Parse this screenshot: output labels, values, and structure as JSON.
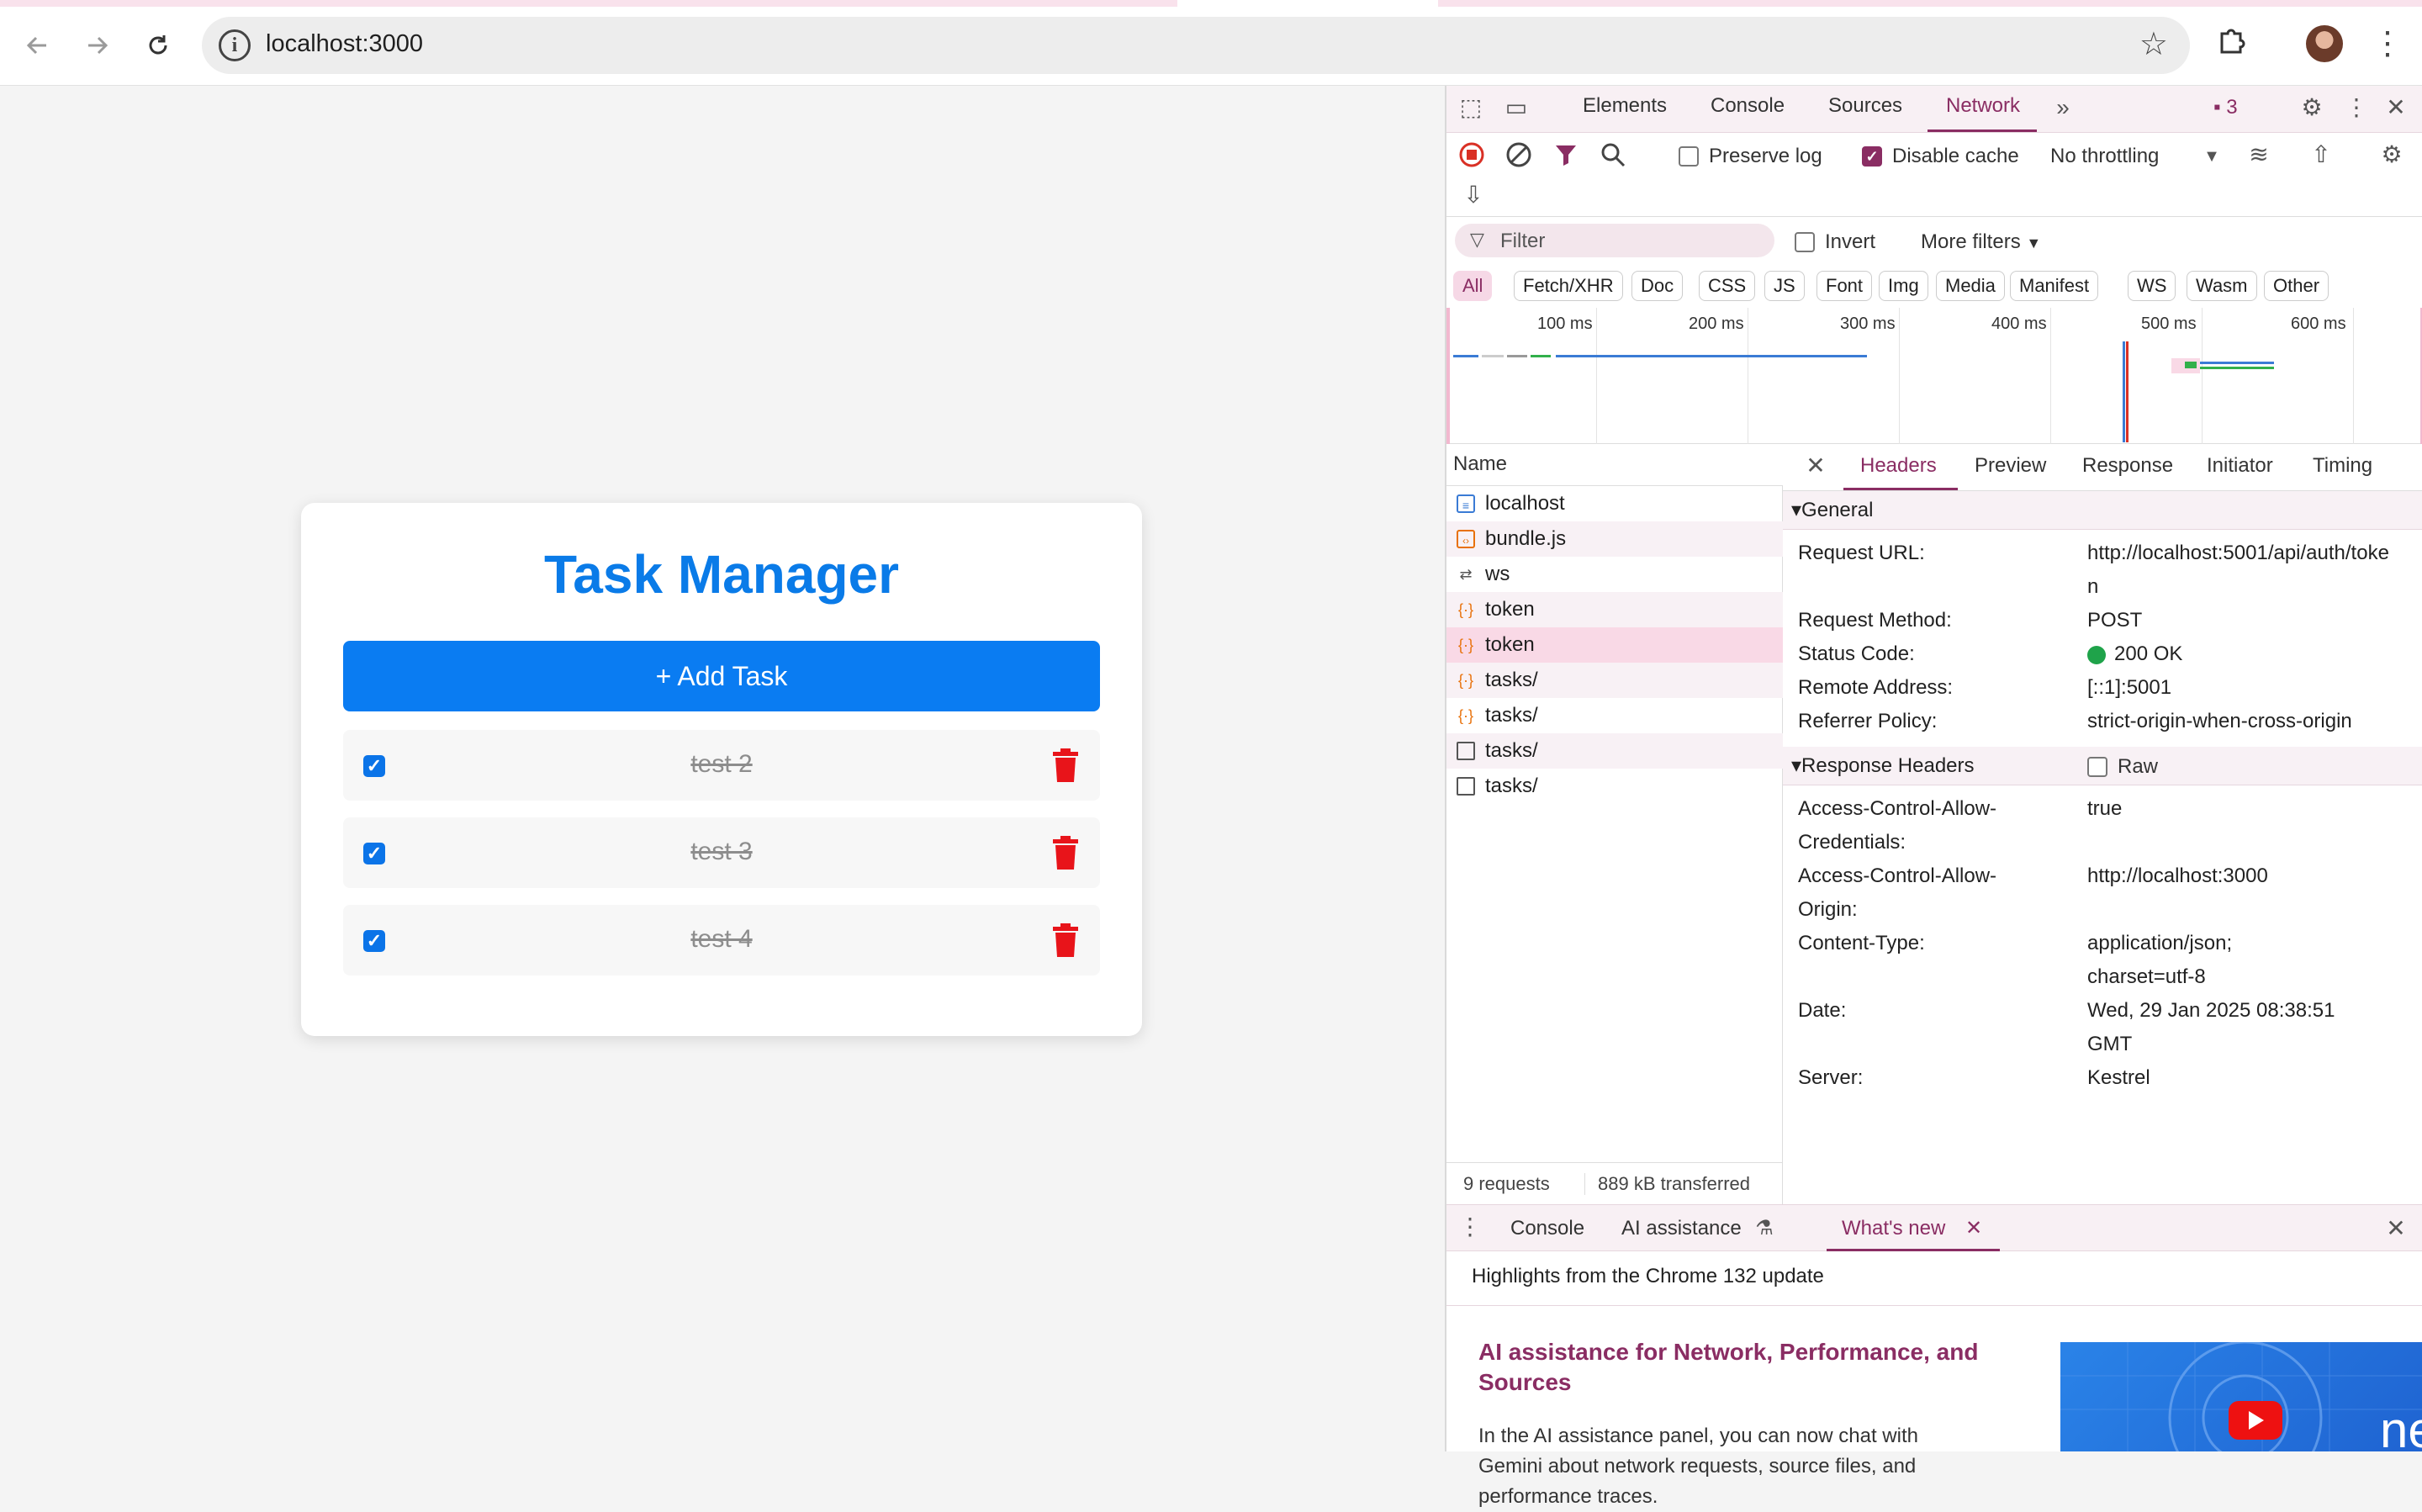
{
  "browser": {
    "url": "localhost:3000",
    "nav": {
      "back_icon": "arrow-left-icon",
      "forward_icon": "arrow-right-icon",
      "reload_icon": "reload-icon"
    }
  },
  "app": {
    "title": "Task Manager",
    "add_button": "+ Add Task",
    "tasks": [
      {
        "label": "test 2",
        "done": true
      },
      {
        "label": "test 3",
        "done": true
      },
      {
        "label": "test 4",
        "done": true
      }
    ],
    "colors": {
      "accent": "#0a7cf2",
      "delete": "#e8141a"
    }
  },
  "devtools": {
    "tabs": [
      "Elements",
      "Console",
      "Sources",
      "Network"
    ],
    "active_tab": "Network",
    "issues_count": "3",
    "toolbar": {
      "preserve_log": "Preserve log",
      "disable_cache": "Disable cache",
      "throttling": "No throttling"
    },
    "filter": {
      "placeholder": "Filter",
      "invert": "Invert",
      "more_filters": "More filters"
    },
    "type_filters": [
      "All",
      "Fetch/XHR",
      "Doc",
      "CSS",
      "JS",
      "Font",
      "Img",
      "Media",
      "Manifest",
      "WS",
      "Wasm",
      "Other"
    ],
    "timeline_ticks": [
      "100 ms",
      "200 ms",
      "300 ms",
      "400 ms",
      "500 ms",
      "600 ms"
    ],
    "requests_header": "Name",
    "requests": [
      {
        "name": "localhost",
        "icon": "doc-icon"
      },
      {
        "name": "bundle.js",
        "icon": "script-icon"
      },
      {
        "name": "ws",
        "icon": "websocket-icon"
      },
      {
        "name": "token",
        "icon": "fetch-icon"
      },
      {
        "name": "token",
        "icon": "fetch-icon",
        "selected": true
      },
      {
        "name": "tasks/",
        "icon": "fetch-icon"
      },
      {
        "name": "tasks/",
        "icon": "fetch-icon"
      },
      {
        "name": "tasks/",
        "icon": "blank-icon"
      },
      {
        "name": "tasks/",
        "icon": "blank-icon"
      }
    ],
    "summary": {
      "requests": "9 requests",
      "transferred": "889 kB transferred"
    },
    "detail_tabs": [
      "Headers",
      "Preview",
      "Response",
      "Initiator",
      "Timing"
    ],
    "general": {
      "title": "General",
      "rows": [
        {
          "k": "Request URL:",
          "v": "http://localhost:5001/api/auth/toke",
          "v2": "n"
        },
        {
          "k": "Request Method:",
          "v": "POST"
        },
        {
          "k": "Status Code:",
          "v": "200 OK"
        },
        {
          "k": "Remote Address:",
          "v": "[::1]:5001"
        },
        {
          "k": "Referrer Policy:",
          "v": "strict-origin-when-cross-origin"
        }
      ]
    },
    "response_headers": {
      "title": "Response Headers",
      "raw": "Raw",
      "rows": [
        {
          "k": "Access-Control-Allow-",
          "k2": "Credentials:",
          "v": "true"
        },
        {
          "k": "Access-Control-Allow-",
          "k2": "Origin:",
          "v": "http://localhost:3000"
        },
        {
          "k": "Content-Type:",
          "v": "application/json;",
          "v2": "charset=utf-8"
        },
        {
          "k": "Date:",
          "v": "Wed, 29 Jan 2025 08:38:51",
          "v2": "GMT"
        },
        {
          "k": "Server:",
          "v": "Kestrel"
        }
      ]
    },
    "drawer": {
      "tabs": [
        "Console",
        "AI assistance",
        "What's new"
      ],
      "active": "What's new",
      "heading": "Highlights from the Chrome 132 update",
      "promo_title": "AI assistance for Network, Performance, and Sources",
      "promo_body": "In the AI assistance panel, you can now chat with Gemini about network requests, source files, and performance traces.",
      "promo_image_text": "ne"
    },
    "colors": {
      "accent": "#8a2d63",
      "status_ok": "#1fa34a"
    }
  }
}
